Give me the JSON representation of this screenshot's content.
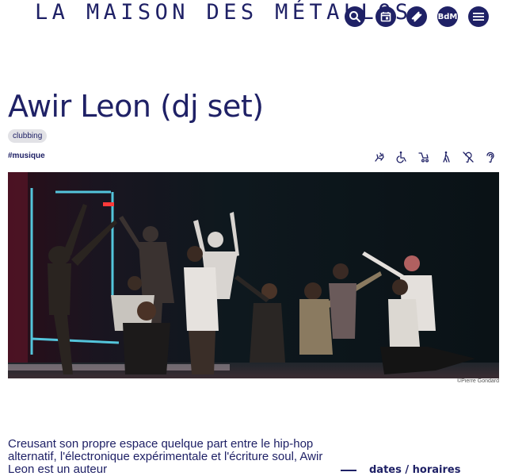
{
  "header": {
    "logo_text": "LA MAISON DES MÉTALLOS",
    "icons": [
      "search-icon",
      "calendar-icon",
      "ticket-icon",
      "bdm-icon",
      "menu-icon"
    ],
    "bdm_label": "BdM"
  },
  "event": {
    "title": "Awir Leon (dj set)",
    "tag": "clubbing",
    "hashtag": "#musique",
    "accessibility_icons": [
      "sign-language-icon",
      "wheelchair-icon",
      "stroller-icon",
      "walking-cane-icon",
      "hearing-loop-icon",
      "ear-icon"
    ],
    "photo_credit": "©Pierre Gondard",
    "intro": "Creusant son propre espace quelque part entre le hip-hop alternatif, l'électronique expérimentale et l'écriture soul, Awir Leon est un auteur",
    "dates_label": "dates / horaires"
  },
  "colors": {
    "brand": "#1f2166",
    "tag_bg": "#e2e2e6",
    "photo_bg": "#0c1419"
  }
}
